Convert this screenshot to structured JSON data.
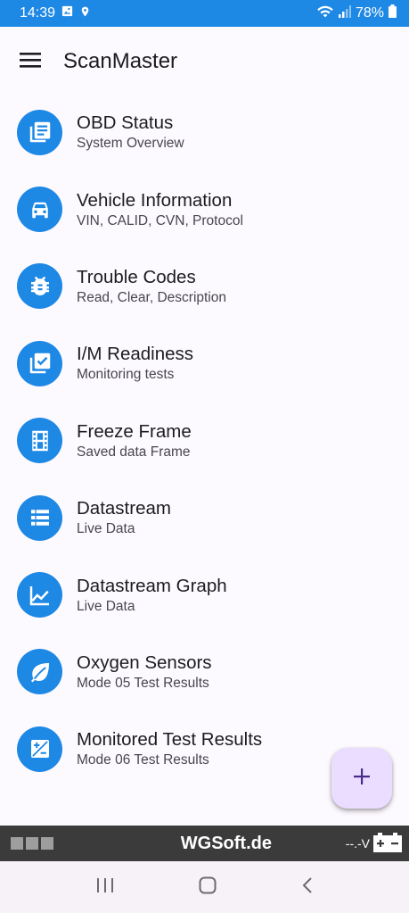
{
  "status_bar": {
    "time": "14:39",
    "battery": "78%",
    "icons": [
      "image-icon",
      "location-icon",
      "wifi-icon",
      "signal-icon",
      "battery-icon"
    ]
  },
  "app_bar": {
    "title": "ScanMaster",
    "menu_icon": "hamburger-menu-icon"
  },
  "menu": {
    "items": [
      {
        "title": "OBD Status",
        "subtitle": "System Overview",
        "icon": "list-document-icon"
      },
      {
        "title": "Vehicle Information",
        "subtitle": "VIN, CALID, CVN, Protocol",
        "icon": "car-icon"
      },
      {
        "title": "Trouble Codes",
        "subtitle": "Read, Clear, Description",
        "icon": "bug-icon"
      },
      {
        "title": "I/M Readiness",
        "subtitle": "Monitoring tests",
        "icon": "checklist-icon"
      },
      {
        "title": "Freeze Frame",
        "subtitle": "Saved data Frame",
        "icon": "film-icon"
      },
      {
        "title": "Datastream",
        "subtitle": "Live Data",
        "icon": "table-list-icon"
      },
      {
        "title": "Datastream Graph",
        "subtitle": "Live Data",
        "icon": "line-chart-icon"
      },
      {
        "title": "Oxygen Sensors",
        "subtitle": "Mode 05 Test Results",
        "icon": "leaf-icon"
      },
      {
        "title": "Monitored Test Results",
        "subtitle": "Mode 06 Test Results",
        "icon": "plus-minus-box-icon"
      }
    ]
  },
  "fab": {
    "icon": "plus-icon"
  },
  "bottom_bar": {
    "brand": "WGSoft.de",
    "voltage": "--.-V",
    "icons": [
      "connection-status-icon",
      "car-battery-icon"
    ]
  },
  "nav_bar": {
    "icons": [
      "recents-icon",
      "home-icon",
      "back-icon"
    ]
  },
  "colors": {
    "primary": "#1e88e5",
    "fab_bg": "#eaddff",
    "fab_icon": "#4a2a8a",
    "bottom_bar": "#3b3b3b"
  }
}
